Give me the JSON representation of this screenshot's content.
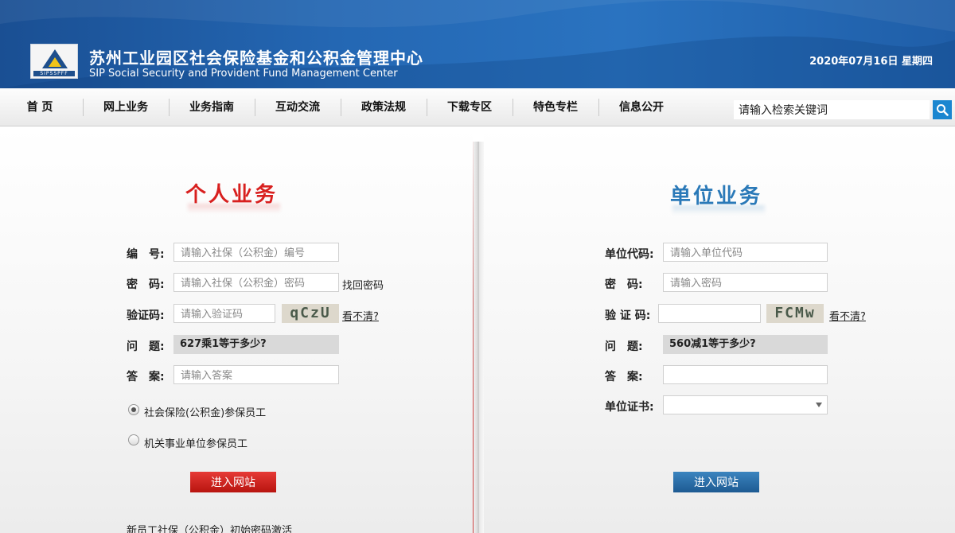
{
  "header": {
    "title_cn": "苏州工业园区社会保险基金和公积金管理中心",
    "title_en": "SIP Social Security and Provident Fund Management Center",
    "logo_text": "SIPSSPFF",
    "date": "2020年07月16日 星期四"
  },
  "nav": {
    "items": [
      "首 页",
      "网上业务",
      "业务指南",
      "互动交流",
      "政策法规",
      "下载专区",
      "特色专栏",
      "信息公开"
    ],
    "search_placeholder": "请输入检索关键词"
  },
  "personal": {
    "heading": "个人业务",
    "id_label": "编　号:",
    "id_placeholder": "请输入社保（公积金）编号",
    "password_label": "密　码:",
    "password_placeholder": "请输入社保（公积金）密码",
    "find_password": "找回密码",
    "captcha_label": "验证码:",
    "captcha_placeholder": "请输入验证码",
    "captcha_text": "qCzU",
    "captcha_refresh": "看不清?",
    "question_label": "问　题:",
    "question_text": "627乘1等于多少?",
    "answer_label": "答　案:",
    "answer_placeholder": "请输入答案",
    "radio_employee": "社会保险(公积金)参保员工",
    "radio_institution": "机关事业单位参保员工",
    "enter_button": "进入网站",
    "activate_link": "新员工社保（公积金）初始密码激活"
  },
  "company": {
    "heading": "单位业务",
    "code_label": "单位代码:",
    "code_placeholder": "请输入单位代码",
    "password_label": "密　码:",
    "password_placeholder": "请输入密码",
    "captcha_label": "验 证 码:",
    "captcha_placeholder": "",
    "captcha_text": "FCMw",
    "captcha_refresh": "看不清?",
    "question_label": "问　题:",
    "question_text": "560减1等于多少?",
    "answer_label": "答　案:",
    "answer_placeholder": "",
    "cert_label": "单位证书:",
    "cert_value": "",
    "enter_button": "进入网站"
  },
  "colors": {
    "header_blue": "#2467b3",
    "personal_red": "#d8201f",
    "company_blue": "#2a79b8"
  }
}
